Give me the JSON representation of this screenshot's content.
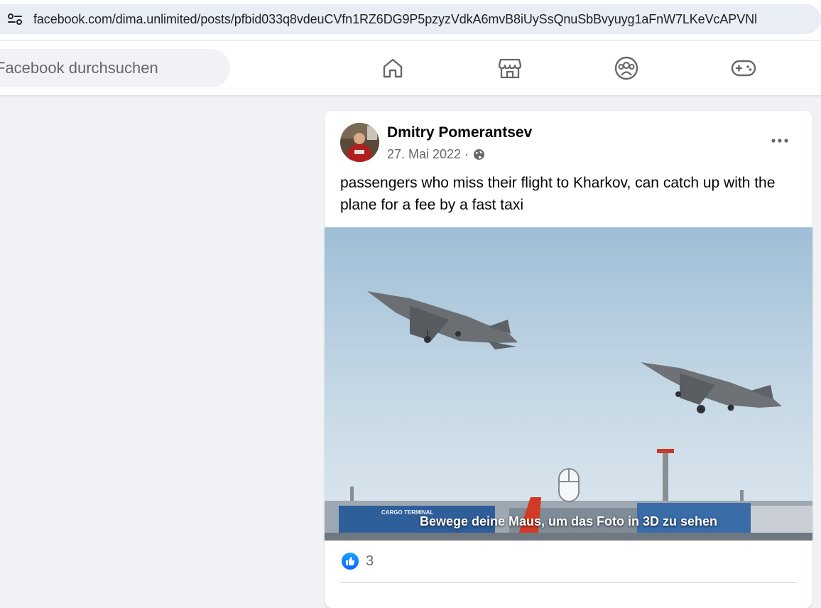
{
  "browser": {
    "url": "facebook.com/dima.unlimited/posts/pfbid033q8vdeuCVfn1RZ6DG9P5pzyzVdkA6mvB8iUySsQnuSbBvyuyg1aFnW7LKeVcAPVNl"
  },
  "header": {
    "search_placeholder": "Facebook durchsuchen",
    "nav": [
      {
        "name": "home",
        "icon": "home-icon"
      },
      {
        "name": "marketplace",
        "icon": "marketplace-icon"
      },
      {
        "name": "groups",
        "icon": "groups-icon"
      },
      {
        "name": "gaming",
        "icon": "gaming-icon"
      }
    ]
  },
  "post": {
    "author": "Dmitry Pomerantsev",
    "date": "27. Mai 2022",
    "meta_separator": "·",
    "text": "passengers who miss their flight to Kharkov, can catch up with the plane for a fee by a fast taxi",
    "photo_caption": "Bewege deine Maus, um das Foto in 3D zu sehen",
    "photo_signage": "CARGO TERMINAL",
    "reaction_count": "3"
  },
  "colors": {
    "fb_blue": "#0866ff",
    "text_primary": "#050505",
    "text_secondary": "#65676b",
    "page_bg": "#f0f2f5"
  }
}
